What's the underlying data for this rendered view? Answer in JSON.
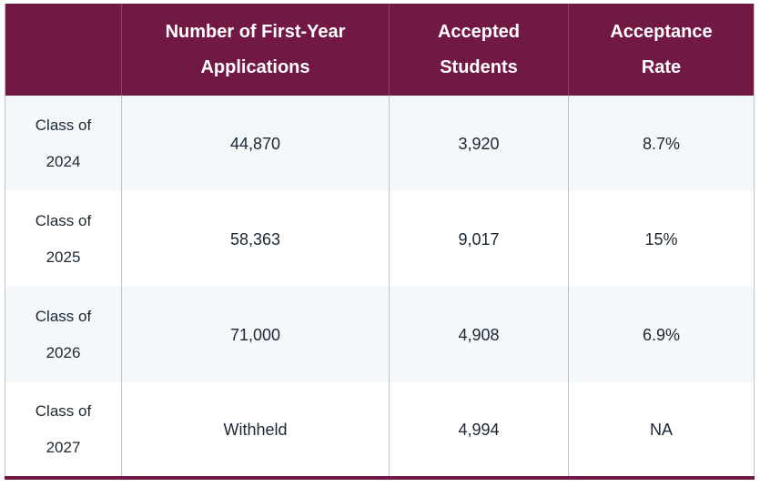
{
  "table": {
    "columns": [
      {
        "key": "label",
        "header": ""
      },
      {
        "key": "applications",
        "header_line1": "Number of First-Year",
        "header_line2": "Applications"
      },
      {
        "key": "accepted",
        "header_line1": "Accepted",
        "header_line2": "Students"
      },
      {
        "key": "rate",
        "header_line1": "Acceptance",
        "header_line2": "Rate"
      }
    ],
    "rows": [
      {
        "label_line1": "Class of",
        "label_line2": "2024",
        "applications": "44,870",
        "accepted": "3,920",
        "rate": "8.7%"
      },
      {
        "label_line1": "Class of",
        "label_line2": "2025",
        "applications": "58,363",
        "accepted": "9,017",
        "rate": "15%"
      },
      {
        "label_line1": "Class of",
        "label_line2": "2026",
        "applications": "71,000",
        "accepted": "4,908",
        "rate": "6.9%"
      },
      {
        "label_line1": "Class of",
        "label_line2": "2027",
        "applications": "Withheld",
        "accepted": "4,994",
        "rate": "NA"
      }
    ]
  },
  "colors": {
    "header_background": "#711845",
    "header_text": "#ffffff",
    "row_alt_background": "#f4f8fb",
    "row_plain_background": "#ffffff",
    "body_text": "#1b2733",
    "column_divider": "#b9c2cf",
    "bottom_rule": "#711845"
  }
}
